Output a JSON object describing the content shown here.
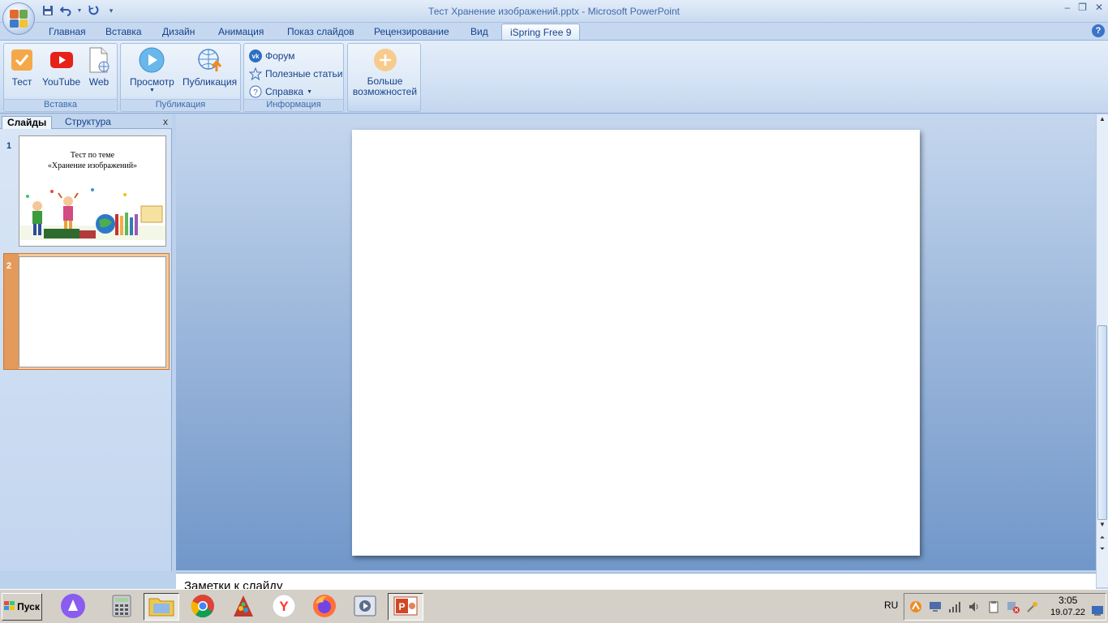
{
  "window": {
    "title": "Тест Хранение изображений.pptx - Microsoft PowerPoint",
    "minimize": "–",
    "restore": "❐",
    "close": "✕"
  },
  "tabs": [
    {
      "label": "Главная"
    },
    {
      "label": "Вставка"
    },
    {
      "label": "Дизайн"
    },
    {
      "label": "Анимация"
    },
    {
      "label": "Показ слайдов"
    },
    {
      "label": "Рецензирование"
    },
    {
      "label": "Вид"
    },
    {
      "label": "iSpring Free 9",
      "active": true
    }
  ],
  "ribbon": {
    "groups": {
      "insert": {
        "label": "Вставка",
        "buttons": [
          {
            "label": "Тест"
          },
          {
            "label": "YouTube"
          },
          {
            "label": "Web"
          }
        ]
      },
      "publish": {
        "label": "Публикация",
        "buttons": [
          {
            "label": "Просмотр"
          },
          {
            "label": "Публикация"
          }
        ]
      },
      "info": {
        "label": "Информация",
        "buttons": [
          {
            "label": "Форум"
          },
          {
            "label": "Полезные статьи"
          },
          {
            "label": "Справка"
          }
        ]
      },
      "more": {
        "label_line1": "Больше",
        "label_line2": "возможностей"
      }
    }
  },
  "slides_pane": {
    "tabs": [
      {
        "label": "Слайды"
      },
      {
        "label": "Структура"
      }
    ],
    "close": "x",
    "slides": [
      {
        "number": "1",
        "title_line1": "Тест по теме",
        "title_line2": "«Хранение изображений»"
      },
      {
        "number": "2",
        "selected": true
      }
    ]
  },
  "notes": {
    "placeholder": "Заметки к слайду"
  },
  "taskbar": {
    "start_label": "Пуск",
    "language": "RU",
    "time": "3:05",
    "date": "19.07.22"
  },
  "colors": {
    "accent": "#15428b",
    "selection": "#e49a5a"
  }
}
